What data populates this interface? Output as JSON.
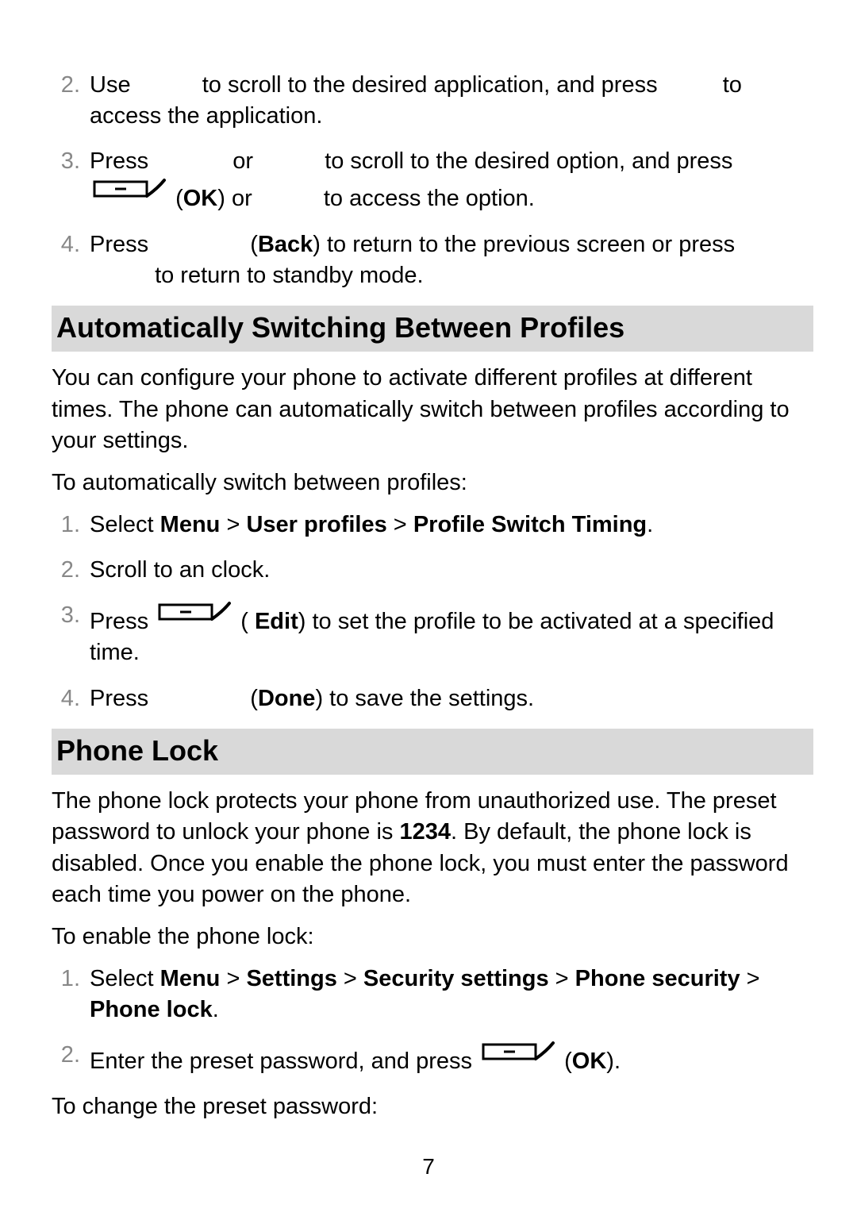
{
  "page_number": "7",
  "intro_list": {
    "items": [
      {
        "n": "2",
        "pre1": "Use",
        "mid1": "to scroll to the desired application, and press",
        "post1": "to access the application."
      },
      {
        "n": "3",
        "pre1": "Press",
        "mid1": "or",
        "mid2": "to scroll to the desired option, and press",
        "line2_pre": "(",
        "ok": "OK",
        "line2_mid": ") or",
        "line2_post": "to access the option."
      },
      {
        "n": "4",
        "pre1": "Press",
        "back_open": "(",
        "back": "Back",
        "back_close": ") to return to the previous screen or press",
        "line2": "to return to standby mode."
      }
    ]
  },
  "section_profiles": {
    "heading": "Automatically Switching Between Profiles",
    "para1": "You can configure your phone to activate different profiles at different times. The phone can automatically switch between profiles according to your settings.",
    "para2": "To automatically switch between profiles:",
    "items": [
      {
        "n": "1",
        "pre": "Select ",
        "b1": "Menu",
        "sep1": " > ",
        "b2": "User profiles",
        "sep2": " > ",
        "b3": "Profile Switch Timing",
        "post": "."
      },
      {
        "n": "2",
        "text": "Scroll to an clock."
      },
      {
        "n": "3",
        "pre": "Press  ",
        "edit_open": "( ",
        "edit": "Edit",
        "edit_close": ") to set the profile to be activated at a specified time."
      },
      {
        "n": "4",
        "pre": "Press",
        "done_open": "(",
        "done": "Done",
        "done_close": ") to save the settings."
      }
    ]
  },
  "section_lock": {
    "heading": "Phone Lock",
    "para1_a": "The phone lock protects your phone from unauthorized use. The preset password to unlock your phone is ",
    "para1_b": "1234",
    "para1_c": ". By default, the phone lock is disabled. Once you enable the phone lock, you must enter the password each time you power on the phone.",
    "para2": "To enable the phone lock:",
    "items": [
      {
        "n": "1",
        "pre": "Select ",
        "b1": "Menu",
        "sep1": " > ",
        "b2": "Settings",
        "sep2": " > ",
        "b3": "Security settings",
        "sep3": " > ",
        "b4": "Phone security",
        "sep4": " > ",
        "b5": "Phone lock",
        "post": "."
      },
      {
        "n": "2",
        "pre": "Enter the preset password, and press ",
        "ok_open": " (",
        "ok": "OK",
        "ok_close": ")."
      }
    ],
    "para3": "To change the preset password:"
  }
}
